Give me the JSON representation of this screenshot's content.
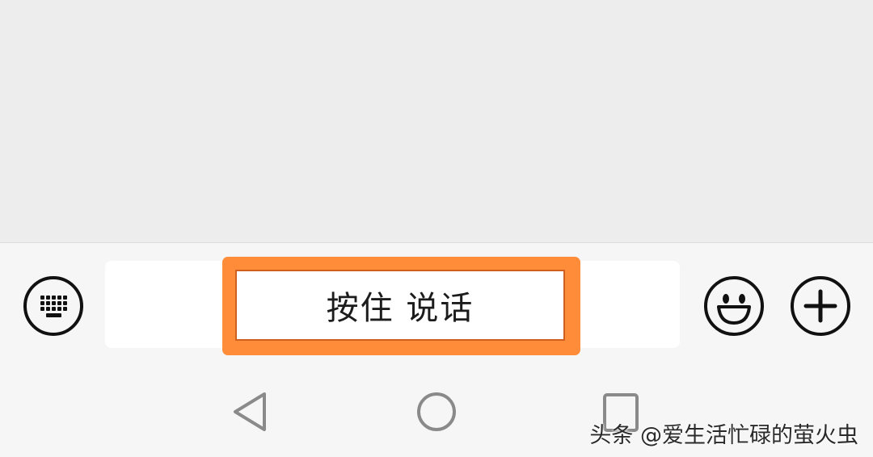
{
  "input_bar": {
    "hold_to_talk_label": "按住 说话",
    "left_icon": "keyboard-icon",
    "right_icons": [
      "emoji-icon",
      "plus-icon"
    ]
  },
  "nav_bar": {
    "icons": [
      "back-icon",
      "home-icon",
      "recents-icon"
    ]
  },
  "watermark": {
    "text": "头条 @爱生活忙碌的萤火虫"
  },
  "colors": {
    "highlight": "#ff8c38",
    "background": "#ededed",
    "bar": "#f6f6f6"
  }
}
